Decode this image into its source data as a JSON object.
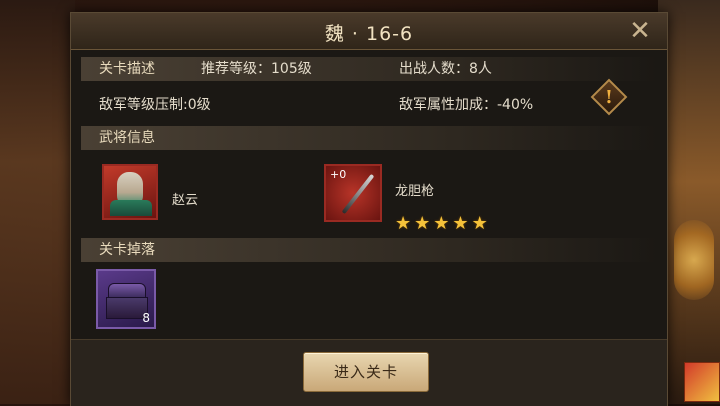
{
  "title": "魏 · 16-6",
  "sections": {
    "stage_desc": "关卡描述",
    "generals": "武将信息",
    "drops": "关卡掉落"
  },
  "stage": {
    "recommended_level": "推荐等级：105级",
    "battle_count": "出战人数：8人",
    "enemy_level_suppression": "敌军等级压制:0级",
    "enemy_attr_bonus": "敌军属性加成：-40%"
  },
  "general": {
    "name": "赵云"
  },
  "weapon": {
    "name": "龙胆枪",
    "refine": "+0",
    "stars": 5
  },
  "drop": {
    "count": "8"
  },
  "buttons": {
    "enter": "进入关卡",
    "close": "✕"
  },
  "icons": {
    "close": "close-icon",
    "hint": "exclamation-icon",
    "star": "star-icon"
  },
  "colors": {
    "star": "#f5c23a",
    "header_text": "#e9dbbd",
    "button_bg": "#e8d6b0"
  }
}
